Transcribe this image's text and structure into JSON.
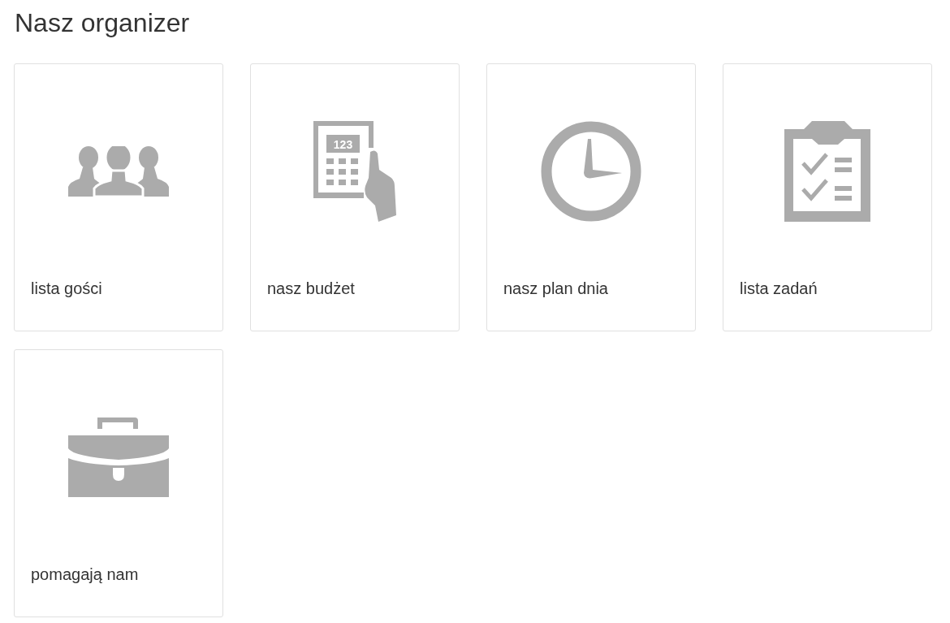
{
  "title": "Nasz organizer",
  "cards": [
    {
      "label": "lista gości",
      "kind": "people"
    },
    {
      "label": "nasz budżet",
      "kind": "calculator",
      "icon_text": "123"
    },
    {
      "label": "nasz plan dnia",
      "kind": "clock"
    },
    {
      "label": "lista zadań",
      "kind": "checklist"
    },
    {
      "label": "pomagają nam",
      "kind": "briefcase"
    }
  ]
}
